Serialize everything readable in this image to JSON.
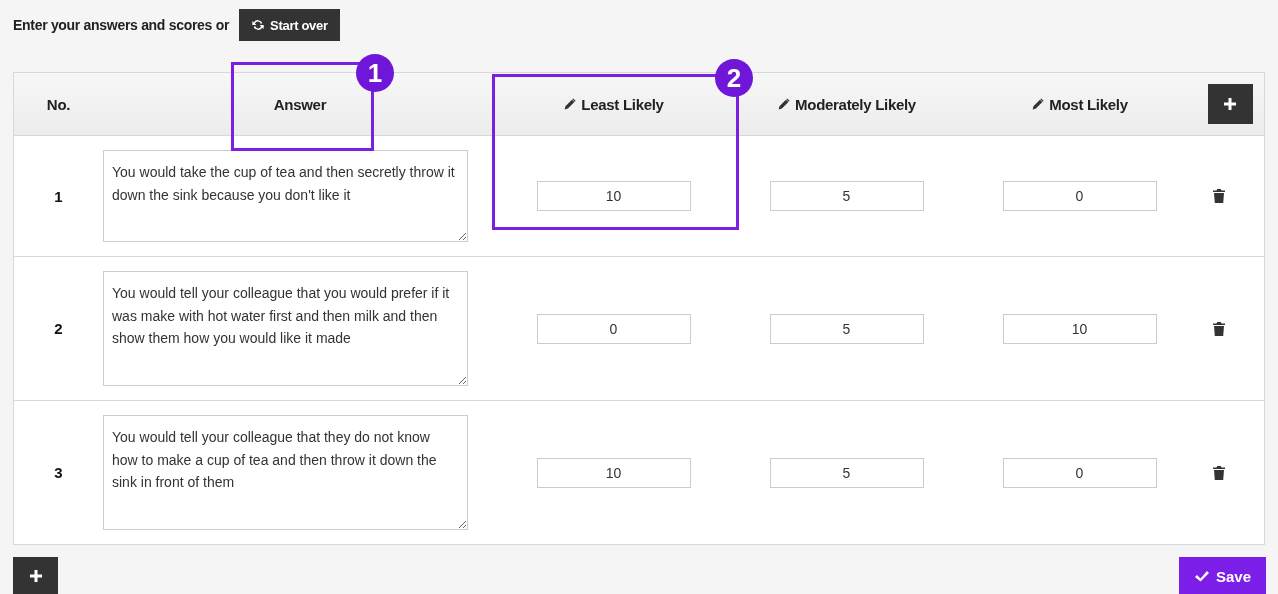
{
  "intro": {
    "text": "Enter your answers and scores or",
    "button": "Start over"
  },
  "table": {
    "columns": [
      {
        "kind": "number",
        "label": "No."
      },
      {
        "kind": "answer",
        "label": "Answer"
      },
      {
        "kind": "score",
        "label": "Least Likely"
      },
      {
        "kind": "score",
        "label": "Moderately Likely"
      },
      {
        "kind": "score",
        "label": "Most Likely"
      }
    ],
    "rows": [
      {
        "number": "1",
        "answer": "You would take the cup of tea and then secretly throw it down the sink because you don't like it",
        "scores": [
          "10",
          "5",
          "0"
        ]
      },
      {
        "number": "2",
        "answer": "You would tell your colleague that you would prefer if it was make with hot water first and then milk and then show them how you would like it made",
        "scores": [
          "0",
          "5",
          "10"
        ]
      },
      {
        "number": "3",
        "answer": "You would tell your colleague that they do not know how to make a cup of tea and then throw it down the sink in front of them",
        "scores": [
          "10",
          "5",
          "0"
        ]
      }
    ]
  },
  "annotations": [
    {
      "label": "1"
    },
    {
      "label": "2"
    }
  ],
  "save_button": "Save"
}
